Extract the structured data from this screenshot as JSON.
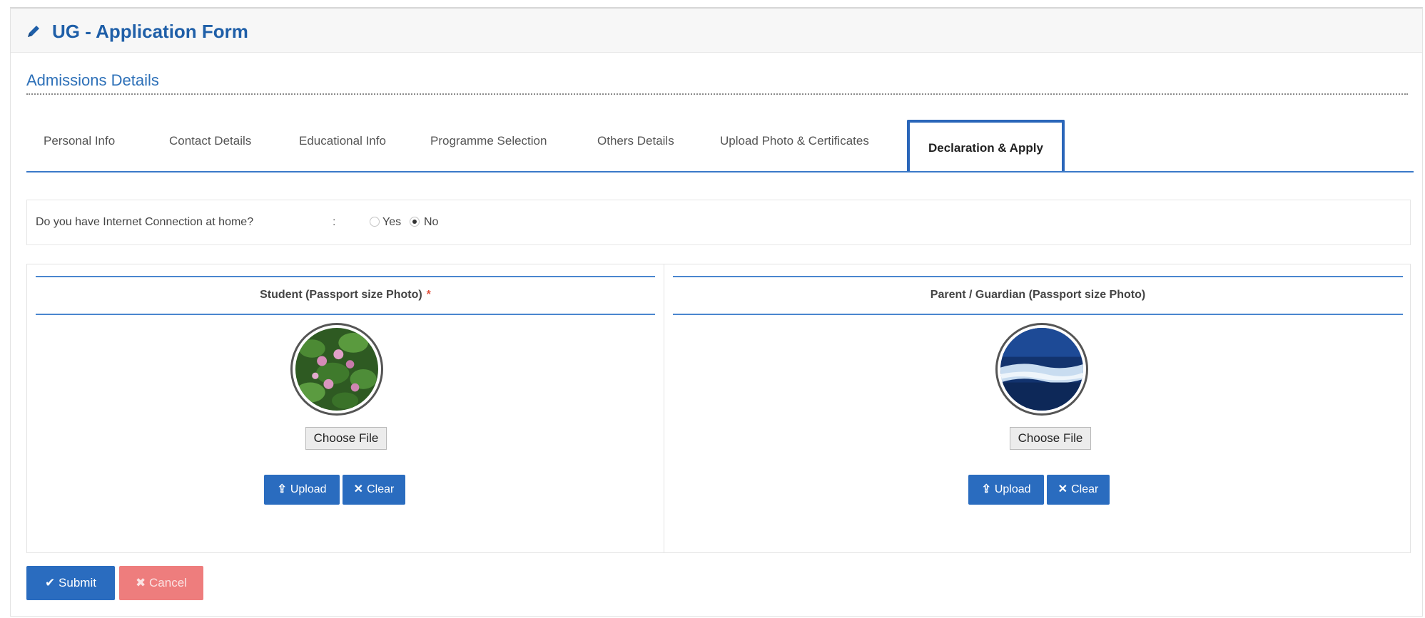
{
  "header": {
    "title": "UG - Application Form",
    "icon": "pencil-icon"
  },
  "section": {
    "title": "Admissions Details"
  },
  "tabs": [
    {
      "label": "Personal Info"
    },
    {
      "label": "Contact Details"
    },
    {
      "label": "Educational Info"
    },
    {
      "label": "Programme Selection"
    },
    {
      "label": "Others Details"
    },
    {
      "label": "Upload Photo & Certificates"
    },
    {
      "label": "Declaration & Apply",
      "active": true
    }
  ],
  "internet_question": {
    "label": "Do you have Internet Connection at home?",
    "separator": ":",
    "options": [
      {
        "label": "Yes",
        "selected": false
      },
      {
        "label": "No",
        "selected": true
      }
    ]
  },
  "student_photo": {
    "title": "Student (Passport size Photo)",
    "required_mark": "*",
    "choose_file_label": "Choose File",
    "upload_label": "Upload",
    "clear_label": "Clear"
  },
  "parent_photo": {
    "title": "Parent / Guardian (Passport size Photo)",
    "choose_file_label": "Choose File",
    "upload_label": "Upload",
    "clear_label": "Clear"
  },
  "actions": {
    "submit_label": "Submit",
    "cancel_label": "Cancel"
  },
  "colors": {
    "primary": "#2a6cbf",
    "title_blue": "#1f5fa8",
    "danger": "#ee7d7d",
    "required": "#e0513c"
  }
}
